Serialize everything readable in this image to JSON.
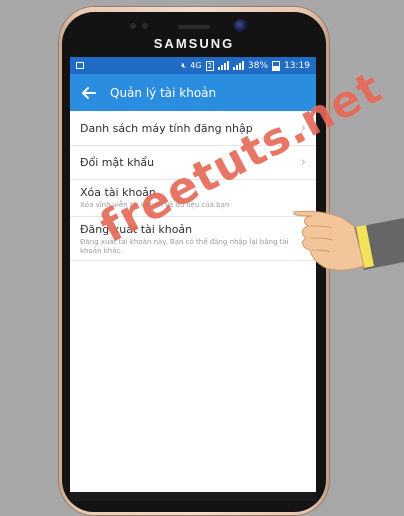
{
  "device": {
    "brand": "SAMSUNG"
  },
  "status_bar": {
    "battery": "38%",
    "time": "13:19",
    "sim": "2",
    "network": "4G"
  },
  "app_bar": {
    "title": "Quản lý tài khoản"
  },
  "menu": {
    "items": [
      {
        "label": "Danh sách máy tính đăng nhập",
        "sub": ""
      },
      {
        "label": "Đổi mật khẩu",
        "sub": ""
      },
      {
        "label": "Xóa tài khoản",
        "sub": "Xóa vĩnh viễn tài khoản và dữ liệu của bạn"
      },
      {
        "label": "Đăng xuất tài khoản",
        "sub": "Đăng xuất tài khoản này. Bạn có thể đăng nhập lại bằng tài khoản khác."
      }
    ]
  },
  "watermark": {
    "text": "freetuts.net"
  },
  "colors": {
    "appbar": "#2b8de0",
    "statusbar": "#1f6bc6",
    "watermark": "#e2503c"
  }
}
